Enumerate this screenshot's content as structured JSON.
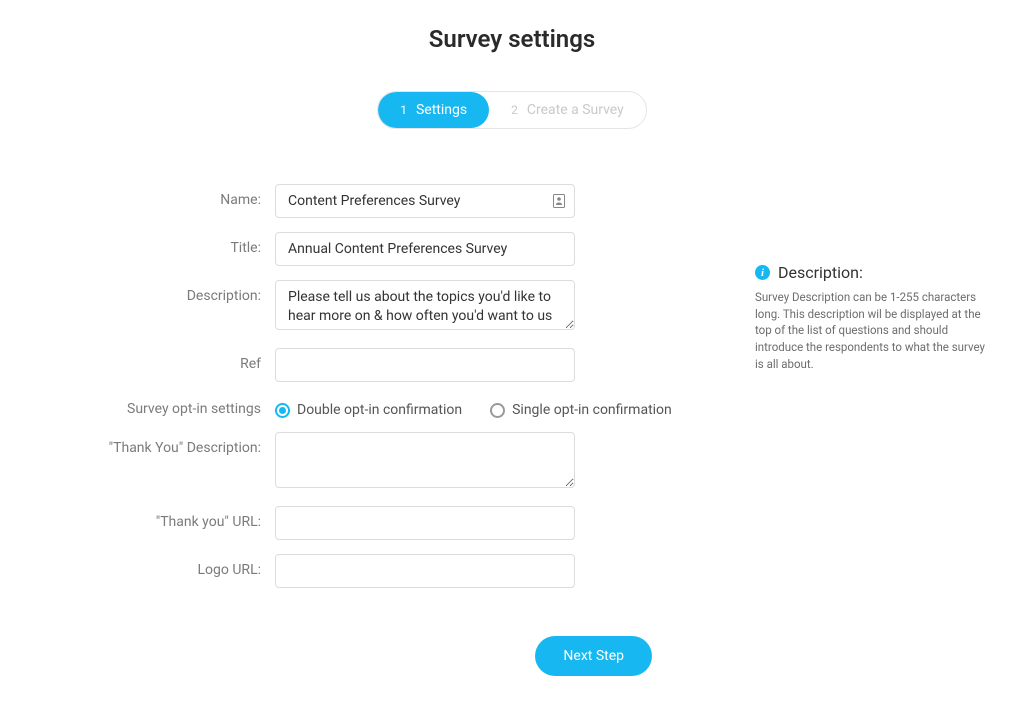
{
  "page": {
    "title": "Survey settings"
  },
  "stepper": {
    "step1": {
      "num": "1",
      "label": "Settings"
    },
    "step2": {
      "num": "2",
      "label": "Create a Survey"
    }
  },
  "form": {
    "name": {
      "label": "Name:",
      "value": "Content Preferences Survey"
    },
    "title": {
      "label": "Title:",
      "value": "Annual Content Preferences Survey"
    },
    "description": {
      "label": "Description:",
      "value": "Please tell us about the topics you'd like to hear more on & how often you'd want to us"
    },
    "ref": {
      "label": "Ref",
      "value": ""
    },
    "optin": {
      "label": "Survey opt-in settings",
      "double": "Double opt-in confirmation",
      "single": "Single opt-in confirmation",
      "selected": "double"
    },
    "thankyouDesc": {
      "label": "\"Thank You\" Description:",
      "value": ""
    },
    "thankyouUrl": {
      "label": "\"Thank you\" URL:",
      "value": ""
    },
    "logoUrl": {
      "label": "Logo URL:",
      "value": ""
    }
  },
  "help": {
    "title": "Description:",
    "body": "Survey Description can be 1-255 characters long. This description wil be displayed at the top of the list of questions and should introduce the respondents to what the survey is all about."
  },
  "actions": {
    "next": "Next Step"
  }
}
